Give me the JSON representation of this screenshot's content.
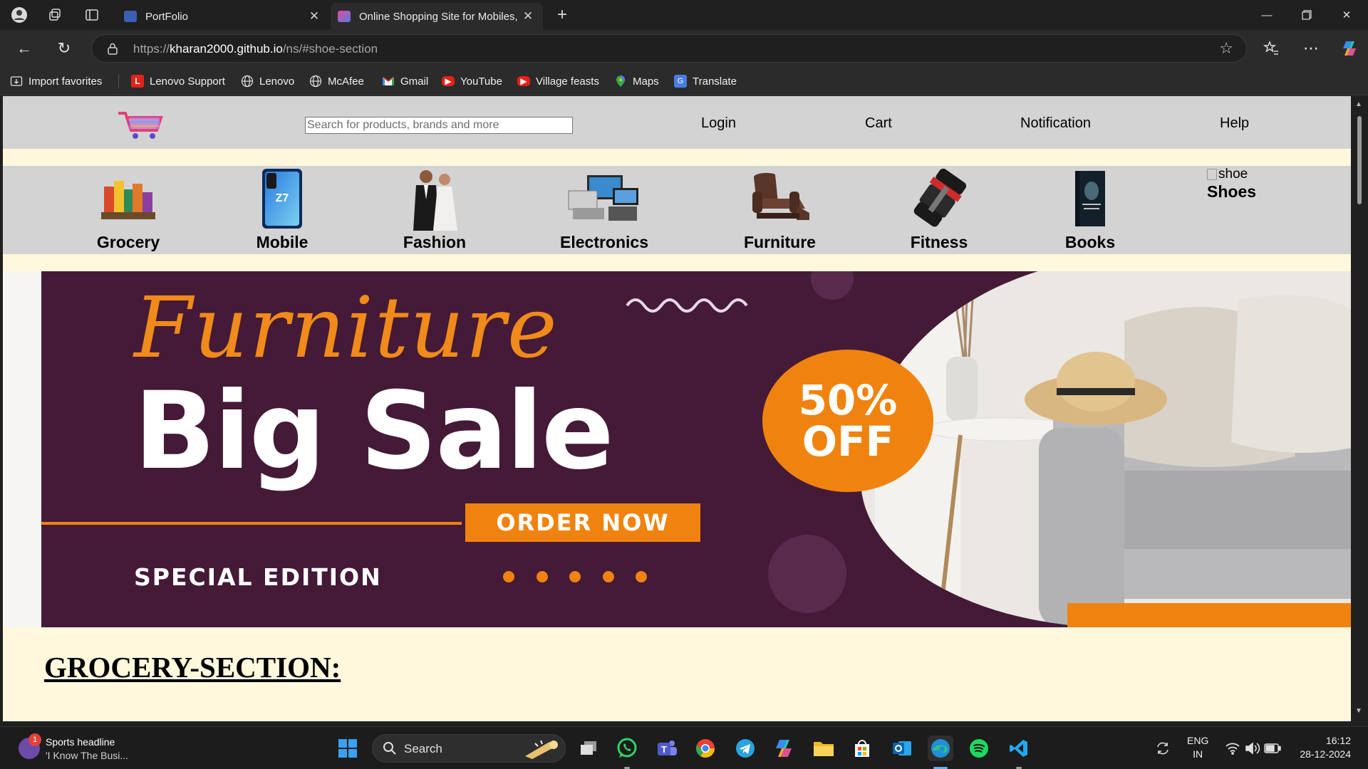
{
  "browser": {
    "tabs": [
      {
        "title": "PortFolio",
        "active": false
      },
      {
        "title": "Online Shopping Site for Mobiles,",
        "active": true
      }
    ],
    "url": {
      "prefix": "https://",
      "host": "kharan2000.github.io",
      "path": "/ns/#shoe-section"
    },
    "favorites": [
      {
        "label": "Import favorites",
        "icon": "import-icon"
      },
      {
        "label": "Lenovo Support",
        "icon": "lenovo-l-icon"
      },
      {
        "label": "Lenovo",
        "icon": "globe-icon"
      },
      {
        "label": "McAfee",
        "icon": "globe-icon"
      },
      {
        "label": "Gmail",
        "icon": "gmail-icon"
      },
      {
        "label": "YouTube",
        "icon": "youtube-icon"
      },
      {
        "label": "Village feasts",
        "icon": "youtube-icon"
      },
      {
        "label": "Maps",
        "icon": "maps-icon"
      },
      {
        "label": "Translate",
        "icon": "translate-icon"
      }
    ]
  },
  "site": {
    "search_placeholder": "Search for products, brands and more",
    "nav": [
      "Login",
      "Cart",
      "Notification",
      "Help"
    ],
    "categories": [
      "Grocery",
      "Mobile",
      "Fashion",
      "Electronics",
      "Furniture",
      "Fitness",
      "Books"
    ],
    "shoes": {
      "alt": "shoe",
      "label": "Shoes"
    },
    "banner": {
      "script": "Furniture",
      "headline": "Big Sale",
      "badge_line1": "50%",
      "badge_line2": "OFF",
      "cta": "ORDER NOW",
      "tagline": "SPECIAL EDITION"
    },
    "section_title": "GROCERY-SECTION:"
  },
  "taskbar": {
    "news_badge": "1",
    "news_title": "Sports headline",
    "news_sub": "'I Know The Busi...",
    "search_label": "Search",
    "lang_line1": "ENG",
    "lang_line2": "IN",
    "time": "16:12",
    "date": "28-12-2024"
  },
  "colors": {
    "page_bg": "#fff8dc",
    "header_bg": "#d3d3d3",
    "banner_bg": "#441a37",
    "banner_accent": "#f0830f"
  }
}
